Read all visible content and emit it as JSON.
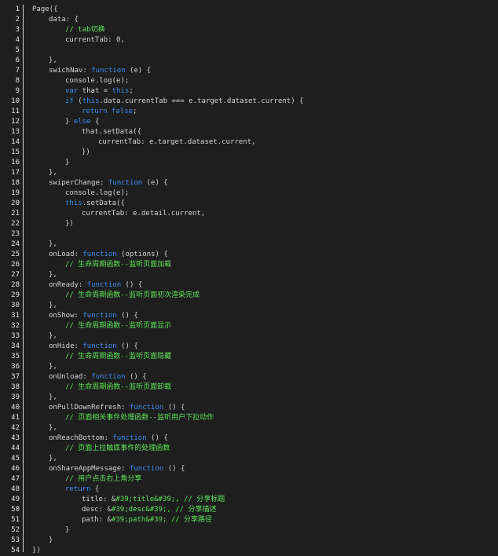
{
  "colors": {
    "background": "#1e1e1e",
    "text": "#d4d4d4",
    "keyword": "#3b8cf0",
    "comment": "#5ee65a",
    "line_number": "#e6e6e6"
  },
  "lines": [
    {
      "n": "1",
      "indent": 0,
      "tokens": [
        {
          "t": "Page({",
          "c": "plain"
        }
      ]
    },
    {
      "n": "2",
      "indent": 1,
      "tokens": [
        {
          "t": "data: {",
          "c": "plain"
        }
      ]
    },
    {
      "n": "3",
      "indent": 2,
      "tokens": [
        {
          "t": "// tab切换",
          "c": "com"
        }
      ]
    },
    {
      "n": "4",
      "indent": 2,
      "tokens": [
        {
          "t": "currentTab: 0,",
          "c": "plain"
        }
      ]
    },
    {
      "n": "5",
      "indent": 1,
      "tokens": []
    },
    {
      "n": "6",
      "indent": 1,
      "tokens": [
        {
          "t": "},",
          "c": "plain"
        }
      ]
    },
    {
      "n": "7",
      "indent": 1,
      "tokens": [
        {
          "t": "swichNav: ",
          "c": "plain"
        },
        {
          "t": "function",
          "c": "kw"
        },
        {
          "t": " (e) {",
          "c": "plain"
        }
      ]
    },
    {
      "n": "8",
      "indent": 2,
      "tokens": [
        {
          "t": "console.log(e);",
          "c": "plain"
        }
      ]
    },
    {
      "n": "9",
      "indent": 2,
      "tokens": [
        {
          "t": "var",
          "c": "kw"
        },
        {
          "t": " that = ",
          "c": "plain"
        },
        {
          "t": "this",
          "c": "kw"
        },
        {
          "t": ";",
          "c": "plain"
        }
      ]
    },
    {
      "n": "10",
      "indent": 2,
      "tokens": [
        {
          "t": "if",
          "c": "kw"
        },
        {
          "t": " (",
          "c": "plain"
        },
        {
          "t": "this",
          "c": "kw"
        },
        {
          "t": ".data.currentTab === e.target.dataset.current) {",
          "c": "plain"
        }
      ]
    },
    {
      "n": "11",
      "indent": 3,
      "tokens": [
        {
          "t": "return false",
          "c": "kw"
        },
        {
          "t": ";",
          "c": "plain"
        }
      ]
    },
    {
      "n": "12",
      "indent": 2,
      "tokens": [
        {
          "t": "} ",
          "c": "plain"
        },
        {
          "t": "else",
          "c": "kw"
        },
        {
          "t": " {",
          "c": "plain"
        }
      ]
    },
    {
      "n": "13",
      "indent": 3,
      "tokens": [
        {
          "t": "that.setData({",
          "c": "plain"
        }
      ]
    },
    {
      "n": "14",
      "indent": 4,
      "tokens": [
        {
          "t": "currentTab: e.target.dataset.current,",
          "c": "plain"
        }
      ]
    },
    {
      "n": "15",
      "indent": 3,
      "tokens": [
        {
          "t": "})",
          "c": "plain"
        }
      ]
    },
    {
      "n": "16",
      "indent": 2,
      "tokens": [
        {
          "t": "}",
          "c": "plain"
        }
      ]
    },
    {
      "n": "17",
      "indent": 1,
      "tokens": [
        {
          "t": "},",
          "c": "plain"
        }
      ]
    },
    {
      "n": "18",
      "indent": 1,
      "tokens": [
        {
          "t": "swiperChange: ",
          "c": "plain"
        },
        {
          "t": "function",
          "c": "kw"
        },
        {
          "t": " (e) {",
          "c": "plain"
        }
      ]
    },
    {
      "n": "19",
      "indent": 2,
      "tokens": [
        {
          "t": "console.log(e);",
          "c": "plain"
        }
      ]
    },
    {
      "n": "20",
      "indent": 2,
      "tokens": [
        {
          "t": "this",
          "c": "kw"
        },
        {
          "t": ".setData({",
          "c": "plain"
        }
      ]
    },
    {
      "n": "21",
      "indent": 3,
      "tokens": [
        {
          "t": "currentTab: e.detail.current,",
          "c": "plain"
        }
      ]
    },
    {
      "n": "22",
      "indent": 2,
      "tokens": [
        {
          "t": "})",
          "c": "plain"
        }
      ]
    },
    {
      "n": "23",
      "indent": 1,
      "tokens": []
    },
    {
      "n": "24",
      "indent": 1,
      "tokens": [
        {
          "t": "},",
          "c": "plain"
        }
      ]
    },
    {
      "n": "25",
      "indent": 1,
      "tokens": [
        {
          "t": "onLoad: ",
          "c": "plain"
        },
        {
          "t": "function",
          "c": "kw"
        },
        {
          "t": " (options) {",
          "c": "plain"
        }
      ]
    },
    {
      "n": "26",
      "indent": 2,
      "tokens": [
        {
          "t": "// 生命周期函数--监听页面加载",
          "c": "com"
        }
      ]
    },
    {
      "n": "27",
      "indent": 1,
      "tokens": [
        {
          "t": "},",
          "c": "plain"
        }
      ]
    },
    {
      "n": "28",
      "indent": 1,
      "tokens": [
        {
          "t": "onReady: ",
          "c": "plain"
        },
        {
          "t": "function",
          "c": "kw"
        },
        {
          "t": " () {",
          "c": "plain"
        }
      ]
    },
    {
      "n": "29",
      "indent": 2,
      "tokens": [
        {
          "t": "// 生命周期函数--监听页面初次渲染完成",
          "c": "com"
        }
      ]
    },
    {
      "n": "30",
      "indent": 1,
      "tokens": [
        {
          "t": "},",
          "c": "plain"
        }
      ]
    },
    {
      "n": "31",
      "indent": 1,
      "tokens": [
        {
          "t": "onShow: ",
          "c": "plain"
        },
        {
          "t": "function",
          "c": "kw"
        },
        {
          "t": " () {",
          "c": "plain"
        }
      ]
    },
    {
      "n": "32",
      "indent": 2,
      "tokens": [
        {
          "t": "// 生命周期函数--监听页面显示",
          "c": "com"
        }
      ]
    },
    {
      "n": "33",
      "indent": 1,
      "tokens": [
        {
          "t": "},",
          "c": "plain"
        }
      ]
    },
    {
      "n": "34",
      "indent": 1,
      "tokens": [
        {
          "t": "onHide: ",
          "c": "plain"
        },
        {
          "t": "function",
          "c": "kw"
        },
        {
          "t": " () {",
          "c": "plain"
        }
      ]
    },
    {
      "n": "35",
      "indent": 2,
      "tokens": [
        {
          "t": "// 生命周期函数--监听页面隐藏",
          "c": "com"
        }
      ]
    },
    {
      "n": "36",
      "indent": 1,
      "tokens": [
        {
          "t": "},",
          "c": "plain"
        }
      ]
    },
    {
      "n": "37",
      "indent": 1,
      "tokens": [
        {
          "t": "onUnload: ",
          "c": "plain"
        },
        {
          "t": "function",
          "c": "kw"
        },
        {
          "t": " () {",
          "c": "plain"
        }
      ]
    },
    {
      "n": "38",
      "indent": 2,
      "tokens": [
        {
          "t": "// 生命周期函数--监听页面卸载",
          "c": "com"
        }
      ]
    },
    {
      "n": "39",
      "indent": 1,
      "tokens": [
        {
          "t": "},",
          "c": "plain"
        }
      ]
    },
    {
      "n": "40",
      "indent": 1,
      "tokens": [
        {
          "t": "onPullDownRefresh: ",
          "c": "plain"
        },
        {
          "t": "function",
          "c": "kw"
        },
        {
          "t": " () {",
          "c": "plain"
        }
      ]
    },
    {
      "n": "41",
      "indent": 2,
      "tokens": [
        {
          "t": "// 页面相关事件处理函数--监听用户下拉动作",
          "c": "com"
        }
      ]
    },
    {
      "n": "42",
      "indent": 1,
      "tokens": [
        {
          "t": "},",
          "c": "plain"
        }
      ]
    },
    {
      "n": "43",
      "indent": 1,
      "tokens": [
        {
          "t": "onReachBottom: ",
          "c": "plain"
        },
        {
          "t": "function",
          "c": "kw"
        },
        {
          "t": " () {",
          "c": "plain"
        }
      ]
    },
    {
      "n": "44",
      "indent": 2,
      "tokens": [
        {
          "t": "// 页面上拉触底事件的处理函数",
          "c": "com"
        }
      ]
    },
    {
      "n": "45",
      "indent": 1,
      "tokens": [
        {
          "t": "},",
          "c": "plain"
        }
      ]
    },
    {
      "n": "46",
      "indent": 1,
      "tokens": [
        {
          "t": "onShareAppMessage: ",
          "c": "plain"
        },
        {
          "t": "function",
          "c": "kw"
        },
        {
          "t": " () {",
          "c": "plain"
        }
      ]
    },
    {
      "n": "47",
      "indent": 2,
      "tokens": [
        {
          "t": "// 用户点击右上角分享",
          "c": "com"
        }
      ]
    },
    {
      "n": "48",
      "indent": 2,
      "tokens": [
        {
          "t": "return",
          "c": "kw"
        },
        {
          "t": " {",
          "c": "plain"
        }
      ]
    },
    {
      "n": "49",
      "indent": 3,
      "tokens": [
        {
          "t": "title: &",
          "c": "plain"
        },
        {
          "t": "#39;title&#39;, // 分享标题",
          "c": "com"
        }
      ]
    },
    {
      "n": "50",
      "indent": 3,
      "tokens": [
        {
          "t": "desc: &",
          "c": "plain"
        },
        {
          "t": "#39;desc&#39;, // 分享描述",
          "c": "com"
        }
      ]
    },
    {
      "n": "51",
      "indent": 3,
      "tokens": [
        {
          "t": "path: &",
          "c": "plain"
        },
        {
          "t": "#39;path&#39; // 分享路径",
          "c": "com"
        }
      ]
    },
    {
      "n": "52",
      "indent": 2,
      "tokens": [
        {
          "t": "}",
          "c": "plain"
        }
      ]
    },
    {
      "n": "53",
      "indent": 1,
      "tokens": [
        {
          "t": "}",
          "c": "plain"
        }
      ]
    },
    {
      "n": "54",
      "indent": 0,
      "tokens": [
        {
          "t": "})",
          "c": "plain"
        }
      ]
    }
  ]
}
